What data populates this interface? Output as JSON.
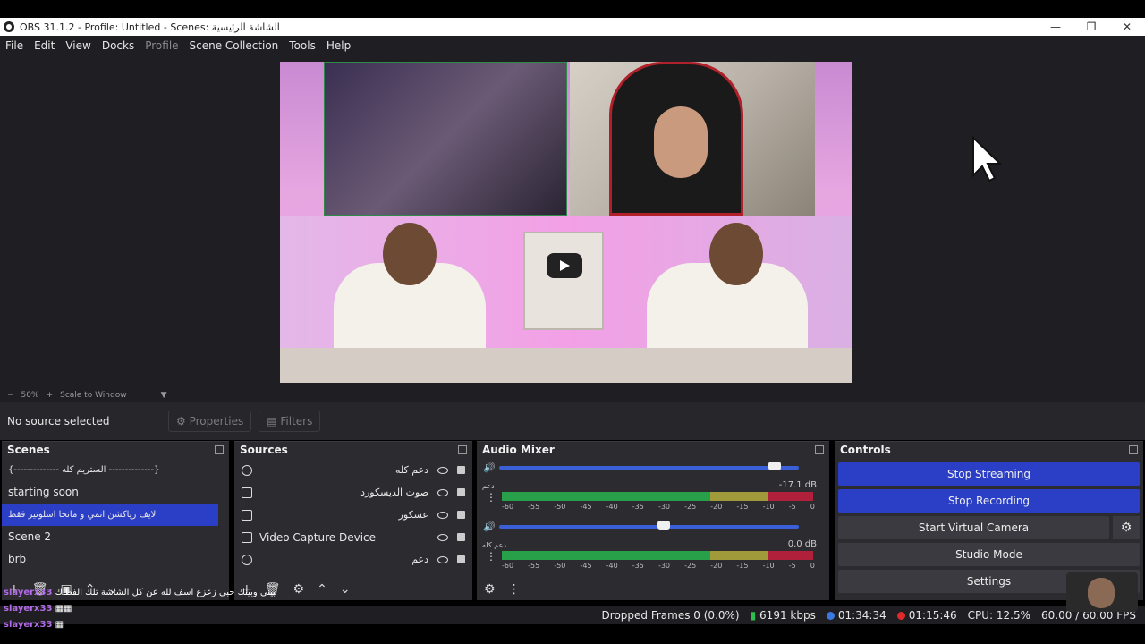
{
  "window": {
    "title": "OBS 31.1.2 - Profile: Untitled - Scenes: الشاشة الرئيسية"
  },
  "menu": [
    "File",
    "Edit",
    "View",
    "Docks",
    "Profile",
    "Scene Collection",
    "Tools",
    "Help"
  ],
  "preview": {
    "zoom": "50%",
    "scale_mode": "Scale to Window"
  },
  "source_bar": {
    "no_source": "No source selected",
    "properties": "Properties",
    "filters": "Filters"
  },
  "scenes": {
    "title": "Scenes",
    "items": [
      "{-------------- الستريم كله --------------}",
      "starting soon",
      "لايف رياكشن انمي و مانجا  اسلوتير فقط",
      "Scene 2",
      "brb"
    ],
    "selected_index": 2
  },
  "sources": {
    "title": "Sources",
    "items": [
      "دعم كله",
      "صوت الديسكورد",
      "عسكور",
      "Video Capture Device",
      "دعم"
    ]
  },
  "mixer": {
    "title": "Audio Mixer",
    "channels": [
      {
        "label": "دعم",
        "db": "-17.1 dB",
        "volume": 0.92
      },
      {
        "label": "دعم كله",
        "db": "0.0 dB",
        "volume": 0.55
      }
    ],
    "ticks": [
      "-60",
      "-55",
      "-50",
      "-45",
      "-40",
      "-35",
      "-30",
      "-25",
      "-20",
      "-15",
      "-10",
      "-5",
      "0"
    ]
  },
  "controls": {
    "title": "Controls",
    "stop_streaming": "Stop Streaming",
    "stop_recording": "Stop Recording",
    "start_virtual_camera": "Start Virtual Camera",
    "studio_mode": "Studio Mode",
    "settings": "Settings"
  },
  "status": {
    "dropped": "Dropped Frames 0 (0.0%)",
    "bitrate": "6191 kbps",
    "stream_time": "01:34:34",
    "rec_time": "01:15:46",
    "cpu": "CPU: 12.5%",
    "fps": "60.00 / 60.00 FPS"
  },
  "chat": [
    {
      "user": "slayerx33",
      "msg": "بيني وبينك حبي زعزع اسف لله عن كل الشاشة تلك الفطاك"
    },
    {
      "user": "slayerx33",
      "msg": ""
    },
    {
      "user": "slayerx33",
      "msg": ""
    }
  ]
}
